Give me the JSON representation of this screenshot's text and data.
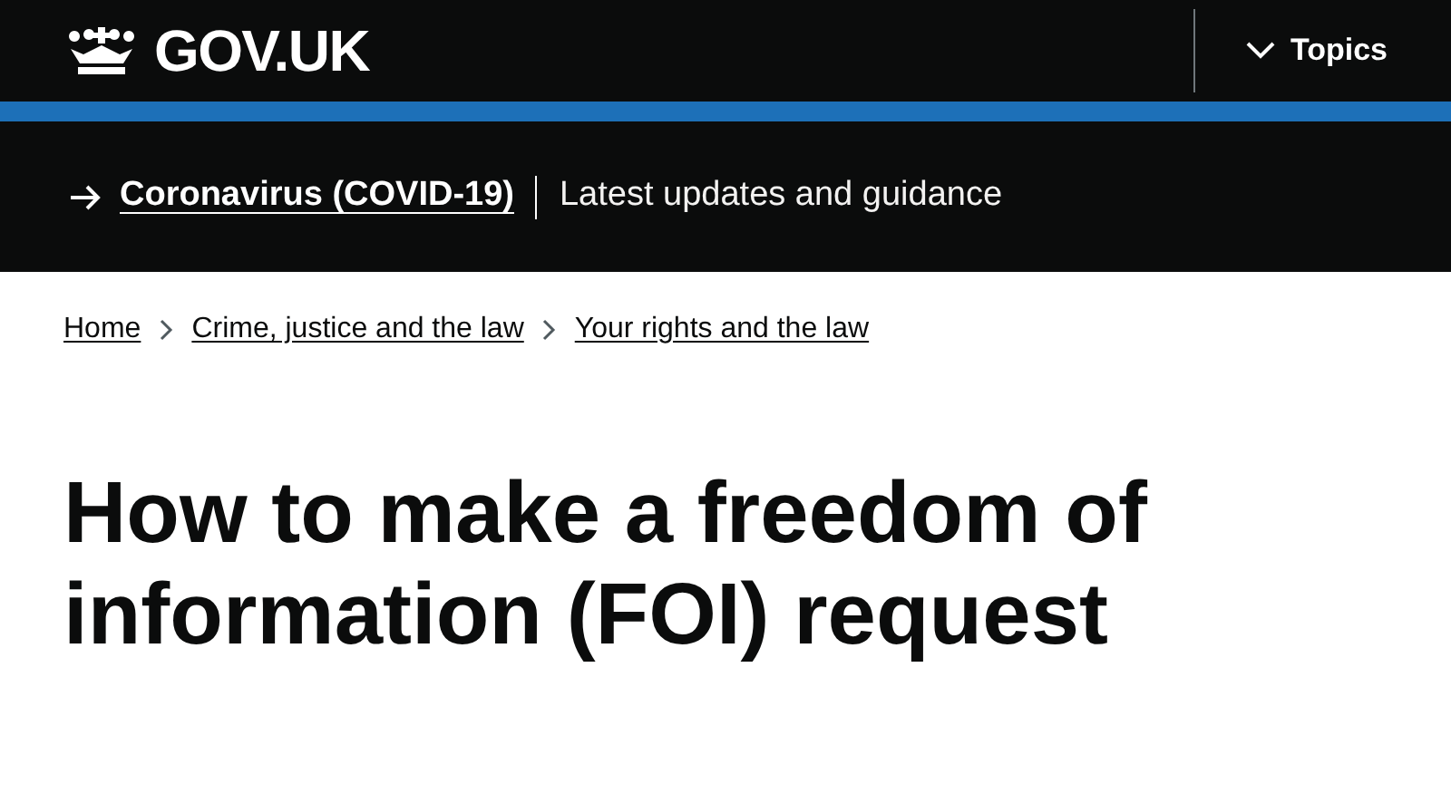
{
  "header": {
    "logo": "GOV.UK",
    "menu": {
      "label": "Topics",
      "expanded": false
    }
  },
  "banner": {
    "link": "Coronavirus (COVID-19)",
    "text": "Latest updates and guidance"
  },
  "breadcrumbs": [
    "Home",
    "Crime, justice and the law",
    "Your rights and the law"
  ],
  "title": "How to make a freedom of information (FOI) request"
}
